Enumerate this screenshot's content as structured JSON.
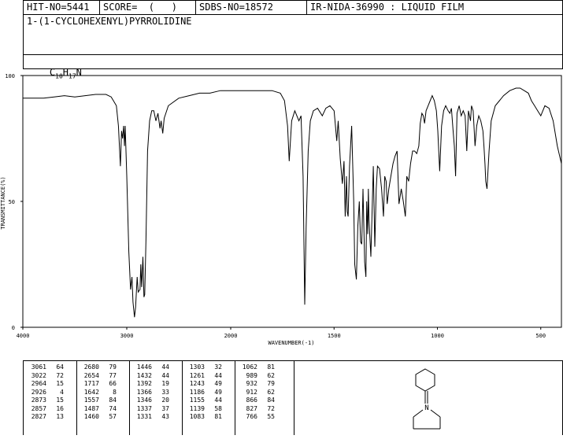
{
  "header": {
    "hit_no": "HIT-NO=5441",
    "score": "SCORE=  (   )",
    "sdbs_no": "SDBS-NO=18572",
    "ir_nida": "IR-NIDA-36990 : LIQUID FILM"
  },
  "compound_name": "1-(1-CYCLOHEXENYL)PYRROLIDINE",
  "formula": {
    "c": "C",
    "c_sub": "10",
    "h": "H",
    "h_sub": "17",
    "n": "N"
  },
  "chart_data": {
    "type": "line",
    "xlabel": "WAVENUMBER(-1)",
    "ylabel": "TRANSMITTANCE(%)",
    "xlim": [
      4000,
      400
    ],
    "ylim": [
      0,
      100
    ],
    "x_ticks": [
      "4000",
      "3000",
      "2000",
      "1500",
      "1000",
      "500"
    ],
    "y_ticks": [
      "100",
      "50",
      "0"
    ],
    "grid": false,
    "series": [
      {
        "x": [
          4000,
          3900,
          3800,
          3700,
          3600,
          3500,
          3400,
          3300,
          3200,
          3150,
          3100,
          3080,
          3061,
          3050,
          3040,
          3030,
          3022,
          3015,
          3000,
          2980,
          2964,
          2950,
          2940,
          2926,
          2915,
          2900,
          2890,
          2873,
          2865,
          2857,
          2845,
          2835,
          2827,
          2815,
          2800,
          2780,
          2760,
          2740,
          2720,
          2700,
          2680,
          2670,
          2654,
          2640,
          2600,
          2500,
          2400,
          2300,
          2200,
          2100,
          2000,
          1900,
          1800,
          1760,
          1740,
          1725,
          1717,
          1705,
          1690,
          1680,
          1670,
          1660,
          1650,
          1642,
          1635,
          1625,
          1615,
          1600,
          1580,
          1557,
          1540,
          1520,
          1500,
          1487,
          1480,
          1470,
          1460,
          1452,
          1446,
          1440,
          1436,
          1432,
          1425,
          1415,
          1405,
          1400,
          1392,
          1385,
          1378,
          1372,
          1366,
          1360,
          1352,
          1346,
          1342,
          1337,
          1334,
          1331,
          1322,
          1310,
          1303,
          1296,
          1290,
          1280,
          1270,
          1261,
          1255,
          1248,
          1243,
          1235,
          1225,
          1215,
          1205,
          1195,
          1186,
          1175,
          1165,
          1155,
          1148,
          1139,
          1130,
          1120,
          1110,
          1100,
          1090,
          1083,
          1075,
          1068,
          1062,
          1055,
          1045,
          1035,
          1025,
          1015,
          1005,
          998,
          989,
          980,
          970,
          960,
          948,
          940,
          932,
          925,
          918,
          912,
          905,
          895,
          885,
          875,
          866,
          858,
          850,
          840,
          835,
          827,
          818,
          810,
          800,
          790,
          780,
          775,
          770,
          766,
          760,
          750,
          740,
          720,
          700,
          680,
          650,
          620,
          600,
          580,
          560,
          545,
          530,
          515,
          500,
          480,
          460,
          440,
          420,
          400
        ],
        "y": [
          91,
          91,
          91,
          91.5,
          92,
          91.5,
          92,
          92.5,
          92.5,
          91.5,
          88,
          80,
          64,
          78,
          75,
          80,
          72,
          80,
          60,
          30,
          15,
          20,
          10,
          4,
          8,
          20,
          14,
          15,
          25,
          16,
          28,
          12,
          13,
          35,
          70,
          82,
          86,
          86,
          82,
          85,
          79,
          82,
          77,
          83,
          88,
          91,
          92,
          93,
          93,
          94,
          94,
          94,
          94,
          93,
          90,
          80,
          66,
          82,
          86,
          84,
          82,
          84,
          60,
          9,
          40,
          70,
          82,
          86,
          87,
          84,
          87,
          88,
          86,
          74,
          82,
          67,
          57,
          66,
          44,
          60,
          46,
          44,
          64,
          80,
          50,
          25,
          19,
          40,
          50,
          34,
          33,
          55,
          26,
          20,
          50,
          37,
          55,
          43,
          28,
          64,
          32,
          55,
          64,
          63,
          55,
          44,
          60,
          58,
          49,
          55,
          60,
          65,
          68,
          70,
          49,
          55,
          50,
          44,
          60,
          58,
          65,
          70,
          70,
          69,
          72,
          81,
          85,
          84,
          81,
          86,
          88,
          90,
          92,
          90,
          86,
          78,
          62,
          80,
          86,
          88,
          86,
          85,
          87,
          79,
          72,
          60,
          85,
          88,
          84,
          86,
          84,
          70,
          86,
          82,
          88,
          86,
          72,
          80,
          84,
          82,
          78,
          72,
          65,
          58,
          55,
          70,
          82,
          88,
          90,
          92,
          94,
          95,
          95,
          94,
          93,
          90,
          88,
          86,
          84,
          88,
          87,
          82,
          72,
          65
        ]
      }
    ]
  },
  "peaks": [
    [
      [
        "3061",
        "64"
      ],
      [
        "3022",
        "72"
      ],
      [
        "2964",
        "15"
      ],
      [
        "2926",
        "4"
      ],
      [
        "2873",
        "15"
      ],
      [
        "2857",
        "16"
      ],
      [
        "2827",
        "13"
      ]
    ],
    [
      [
        "2680",
        "79"
      ],
      [
        "2654",
        "77"
      ],
      [
        "1717",
        "66"
      ],
      [
        "1642",
        "8"
      ],
      [
        "1557",
        "84"
      ],
      [
        "1487",
        "74"
      ],
      [
        "1460",
        "57"
      ]
    ],
    [
      [
        "1446",
        "44"
      ],
      [
        "1432",
        "44"
      ],
      [
        "1392",
        "19"
      ],
      [
        "1366",
        "33"
      ],
      [
        "1346",
        "20"
      ],
      [
        "1337",
        "37"
      ],
      [
        "1331",
        "43"
      ]
    ],
    [
      [
        "1303",
        "32"
      ],
      [
        "1261",
        "44"
      ],
      [
        "1243",
        "49"
      ],
      [
        "1186",
        "49"
      ],
      [
        "1155",
        "44"
      ],
      [
        "1139",
        "58"
      ],
      [
        "1083",
        "81"
      ]
    ],
    [
      [
        "1062",
        "81"
      ],
      [
        "989",
        "62"
      ],
      [
        "932",
        "79"
      ],
      [
        "912",
        "62"
      ],
      [
        "866",
        "84"
      ],
      [
        "827",
        "72"
      ],
      [
        "766",
        "55"
      ]
    ]
  ],
  "structure": {
    "atom_label": "N"
  }
}
